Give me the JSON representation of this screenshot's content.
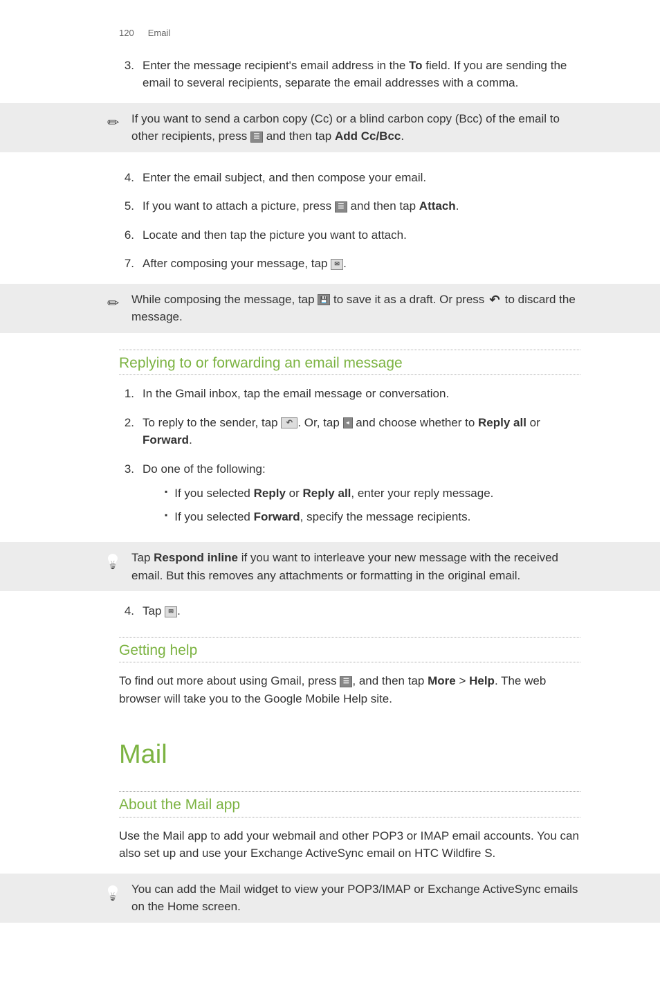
{
  "header": {
    "page_number": "120",
    "section": "Email"
  },
  "steps_a": {
    "s3": {
      "num": "3.",
      "p1": "Enter the message recipient's email address in the ",
      "b1": "To",
      "p2": " field. If you are sending the email to several recipients, separate the email addresses with a comma."
    }
  },
  "note1": {
    "p1": "If you want to send a carbon copy (Cc) or a blind carbon copy (Bcc) of the email to other recipients, press ",
    "p2": " and then tap ",
    "b1": "Add Cc/Bcc",
    "p3": "."
  },
  "steps_b": {
    "s4": {
      "num": "4.",
      "text": "Enter the email subject, and then compose your email."
    },
    "s5": {
      "num": "5.",
      "p1": "If you want to attach a picture, press ",
      "p2": " and then tap ",
      "b1": "Attach",
      "p3": "."
    },
    "s6": {
      "num": "6.",
      "text": "Locate and then tap the picture you want to attach."
    },
    "s7": {
      "num": "7.",
      "p1": "After composing your message, tap ",
      "p2": "."
    }
  },
  "note2": {
    "p1": "While composing the message, tap ",
    "p2": " to save it as a draft. Or press ",
    "p3": " to discard the message."
  },
  "section_reply": {
    "heading": "Replying to or forwarding an email message",
    "s1": {
      "num": "1.",
      "text": "In the Gmail inbox, tap the email message or conversation."
    },
    "s2": {
      "num": "2.",
      "p1": "To reply to the sender, tap ",
      "p2": ". Or, tap ",
      "p3": " and choose whether to ",
      "b1": "Reply all",
      "p4": " or ",
      "b2": "Forward",
      "p5": "."
    },
    "s3": {
      "num": "3.",
      "text": "Do one of the following:"
    },
    "bullet1": {
      "p1": "If you selected ",
      "b1": "Reply",
      "p2": " or ",
      "b2": "Reply all",
      "p3": ", enter your reply message."
    },
    "bullet2": {
      "p1": "If you selected ",
      "b1": "Forward",
      "p2": ", specify the message recipients."
    }
  },
  "note3": {
    "p1": "Tap ",
    "b1": "Respond inline",
    "p2": " if you want to interleave your new message with the received email. But this removes any attachments or formatting in the original email."
  },
  "steps_c": {
    "s4": {
      "num": "4.",
      "p1": "Tap ",
      "p2": "."
    }
  },
  "section_help": {
    "heading": "Getting help",
    "p1": "To find out more about using Gmail, press ",
    "p2": ", and then tap ",
    "b1": "More",
    "p3": " > ",
    "b2": "Help",
    "p4": ". The web browser will take you to the Google Mobile Help site."
  },
  "mail": {
    "heading": "Mail"
  },
  "section_about": {
    "heading": "About the Mail app",
    "text": "Use the Mail app to add your webmail and other POP3 or IMAP email accounts. You can also set up and use your Exchange ActiveSync email on HTC Wildfire S."
  },
  "note4": {
    "text": "You can add the Mail widget to view your POP3/IMAP or Exchange ActiveSync emails on the Home screen."
  }
}
